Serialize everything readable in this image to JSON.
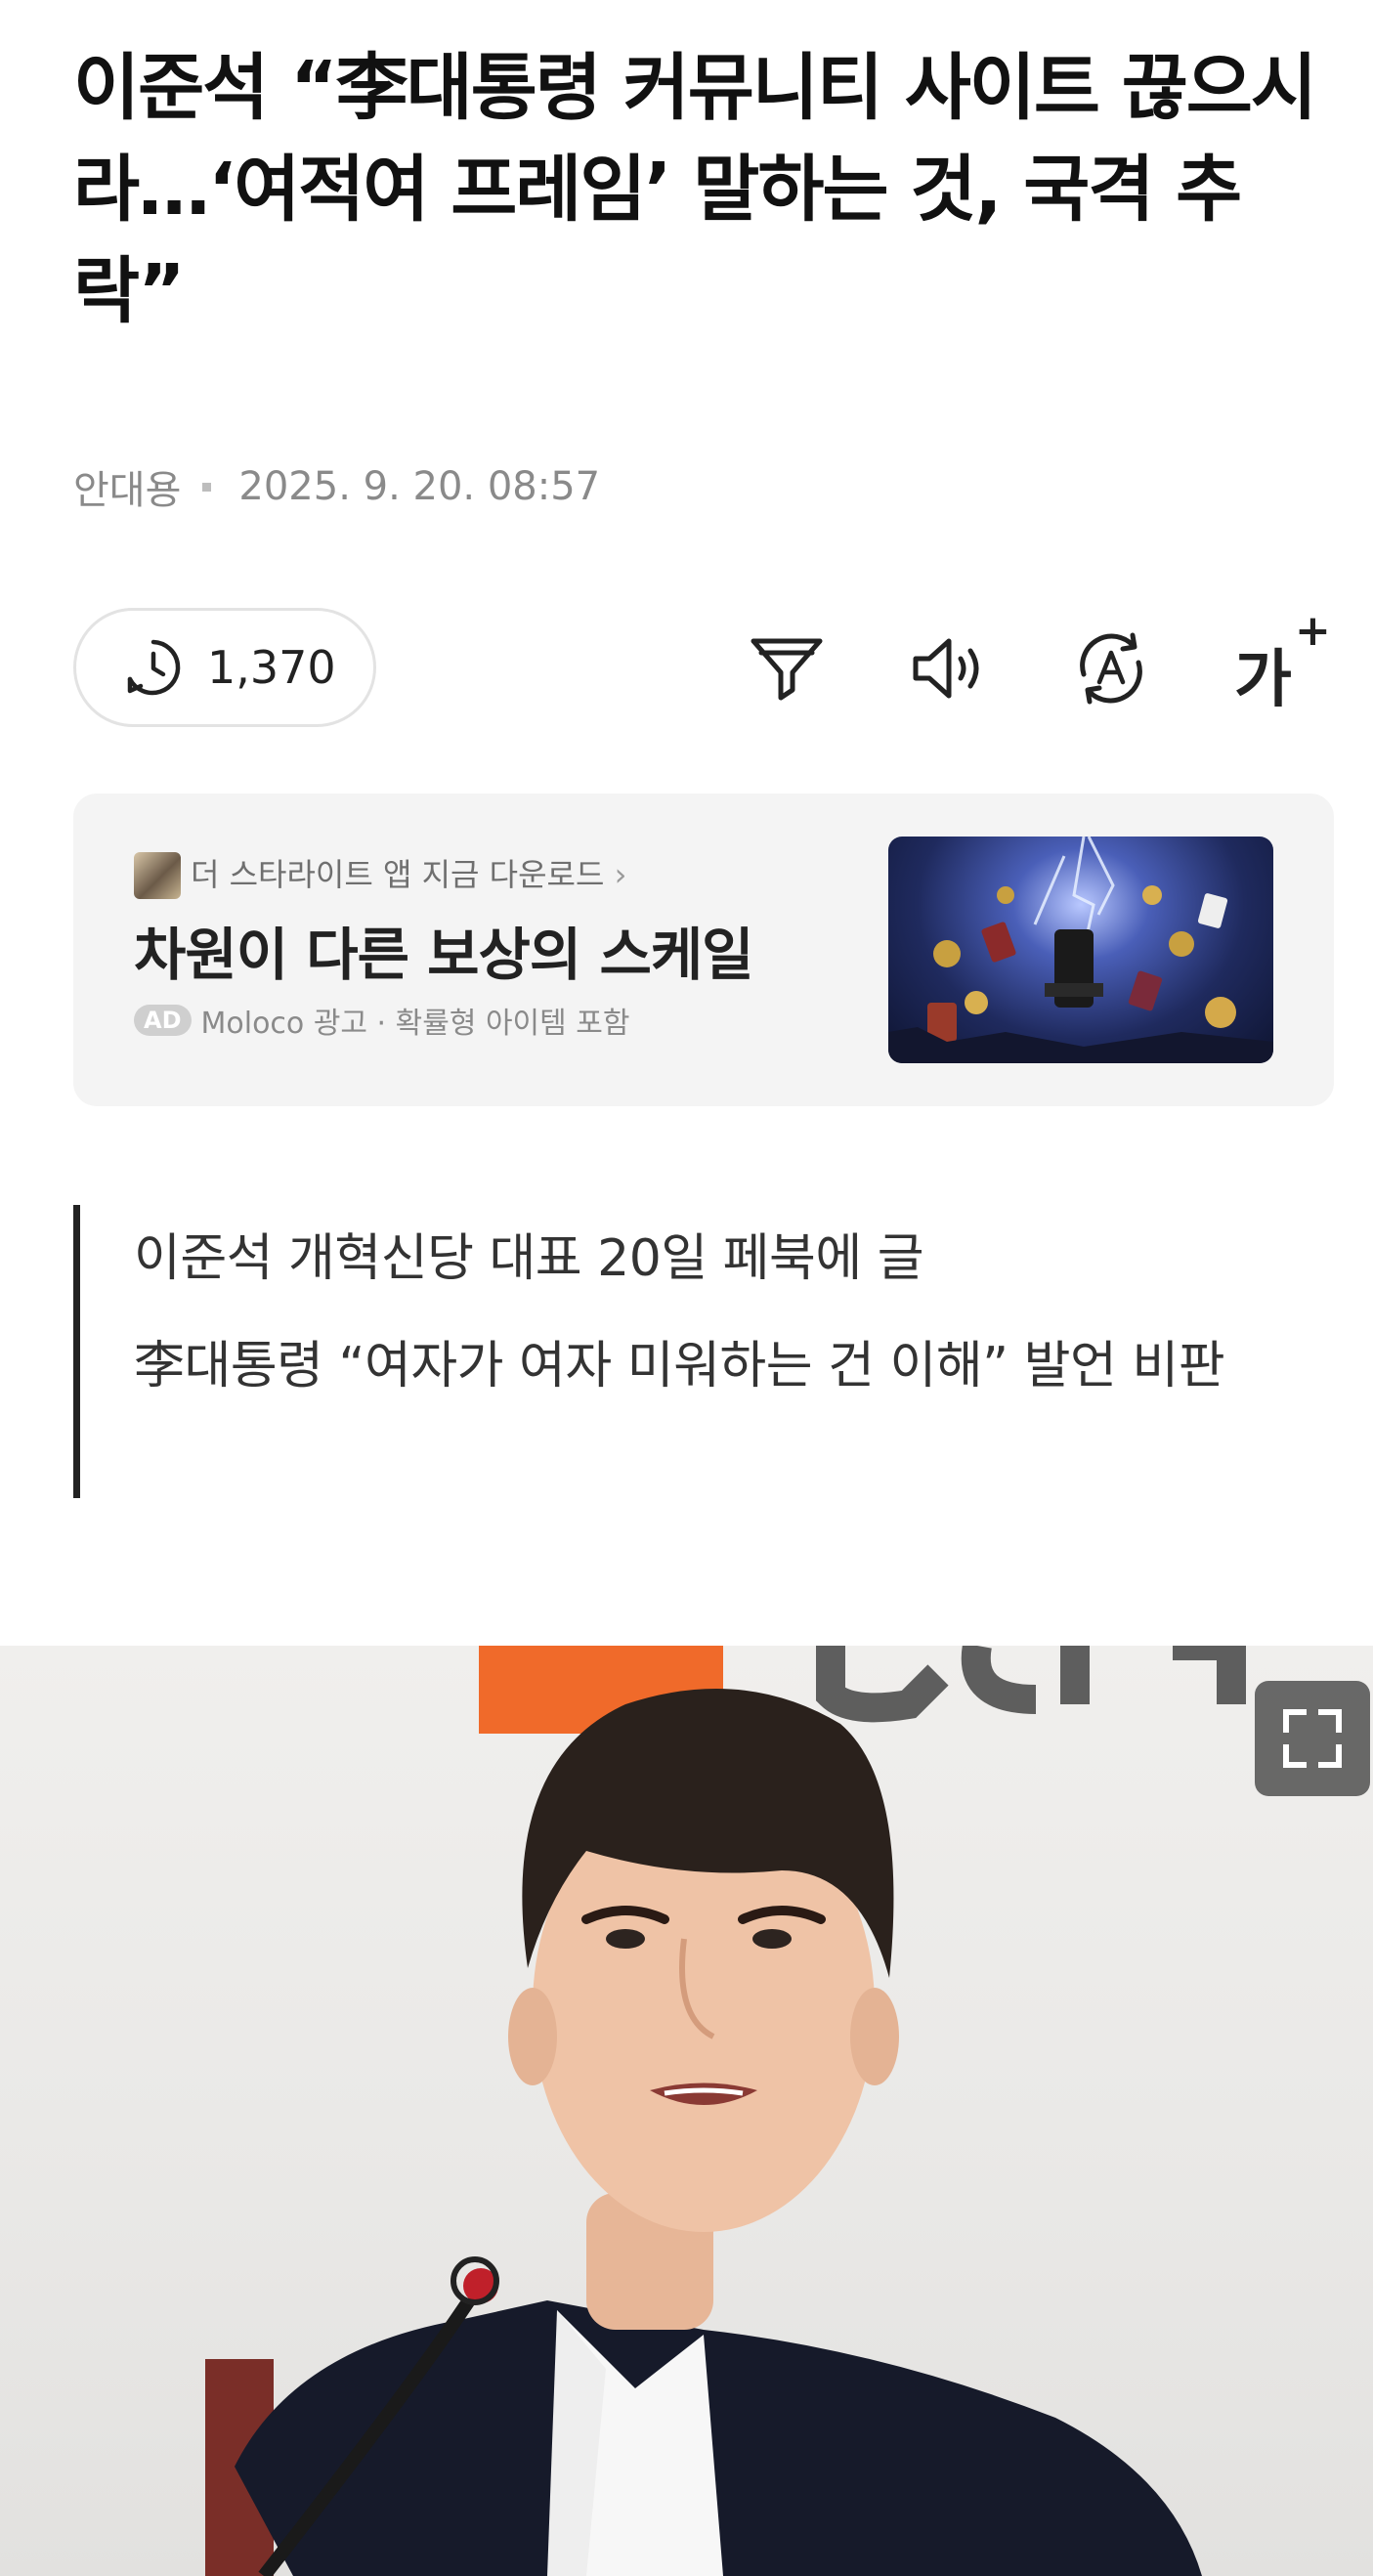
{
  "article": {
    "headline": "이준석 “李대통령 커뮤니티 사이트 끊으시라…‘여적여 프레임’ 말하는 것, 국격 추락”",
    "author": "안대용",
    "datetime": "2025. 9. 20. 08:57"
  },
  "toolbar": {
    "view_count": "1,370",
    "icons": [
      "clock-icon",
      "summary-funnel-icon",
      "speaker-icon",
      "translate-icon",
      "font-size-icon"
    ],
    "font_size_label": "가",
    "font_size_plus": "+"
  },
  "ad": {
    "app_name": "더 스타라이트 앱 지금 다운로드",
    "title": "차원이 다른 보상의 스케일",
    "badge": "AD",
    "sponsor": "Moloco 광고 · 확률형 아이템 포함"
  },
  "summary": {
    "lines": [
      "이준석 개혁신당 대표 20일 페북에 글",
      "李대통령 “여자가 여자 미워하는 건 이해” 발언 비판"
    ]
  },
  "colors": {
    "accent_orange": "#f06a2a",
    "summary_bar": "#222222",
    "ad_background": "#f4f4f4"
  }
}
